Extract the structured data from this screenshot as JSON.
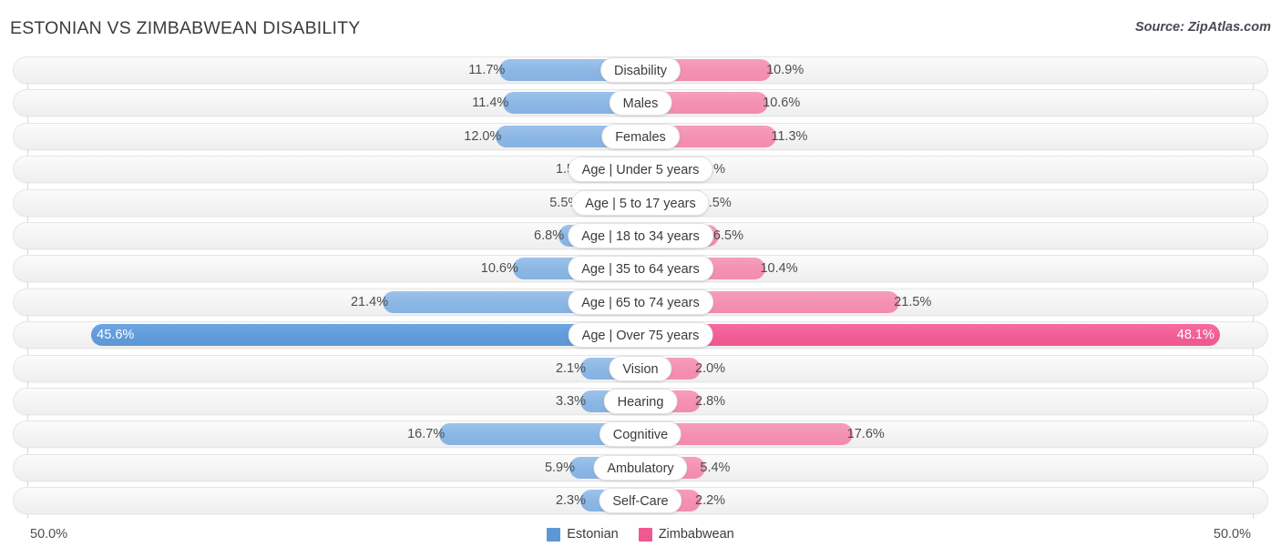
{
  "header": {
    "title": "ESTONIAN VS ZIMBABWEAN DISABILITY",
    "source": "Source: ZipAtlas.com"
  },
  "footer": {
    "axis_left": "50.0%",
    "axis_right": "50.0%",
    "legend": [
      {
        "label": "Estonian",
        "color": "#5d97d6"
      },
      {
        "label": "Zimbabwean",
        "color": "#ef5890"
      }
    ]
  },
  "chart_data": {
    "type": "bar",
    "orientation": "diverging-horizontal",
    "title": "ESTONIAN VS ZIMBABWEAN DISABILITY",
    "xlabel": "",
    "ylabel": "",
    "xlim": [
      50.0,
      50.0
    ],
    "axis_max": 50.0,
    "grid": true,
    "legend_position": "bottom-center",
    "categories": [
      "Disability",
      "Males",
      "Females",
      "Age | Under 5 years",
      "Age | 5 to 17 years",
      "Age | 18 to 34 years",
      "Age | 35 to 64 years",
      "Age | 65 to 74 years",
      "Age | Over 75 years",
      "Vision",
      "Hearing",
      "Cognitive",
      "Ambulatory",
      "Self-Care"
    ],
    "series": [
      {
        "name": "Estonian",
        "color": "#8bb6e4",
        "values": [
          11.7,
          11.4,
          12.0,
          1.5,
          5.5,
          6.8,
          10.6,
          21.4,
          45.6,
          2.1,
          3.3,
          16.7,
          5.9,
          2.3
        ],
        "labels": [
          "11.7%",
          "11.4%",
          "12.0%",
          "1.5%",
          "5.5%",
          "6.8%",
          "10.6%",
          "21.4%",
          "45.6%",
          "2.1%",
          "3.3%",
          "16.7%",
          "5.9%",
          "2.3%"
        ]
      },
      {
        "name": "Zimbabwean",
        "color": "#f490b2",
        "values": [
          10.9,
          10.6,
          11.3,
          1.2,
          5.5,
          6.5,
          10.4,
          21.5,
          48.1,
          2.0,
          2.8,
          17.6,
          5.4,
          2.2
        ],
        "labels": [
          "10.9%",
          "10.6%",
          "11.3%",
          "1.2%",
          "5.5%",
          "6.5%",
          "10.4%",
          "21.5%",
          "48.1%",
          "2.0%",
          "2.8%",
          "17.6%",
          "5.4%",
          "2.2%"
        ]
      }
    ],
    "highlight_row_index": 8
  }
}
